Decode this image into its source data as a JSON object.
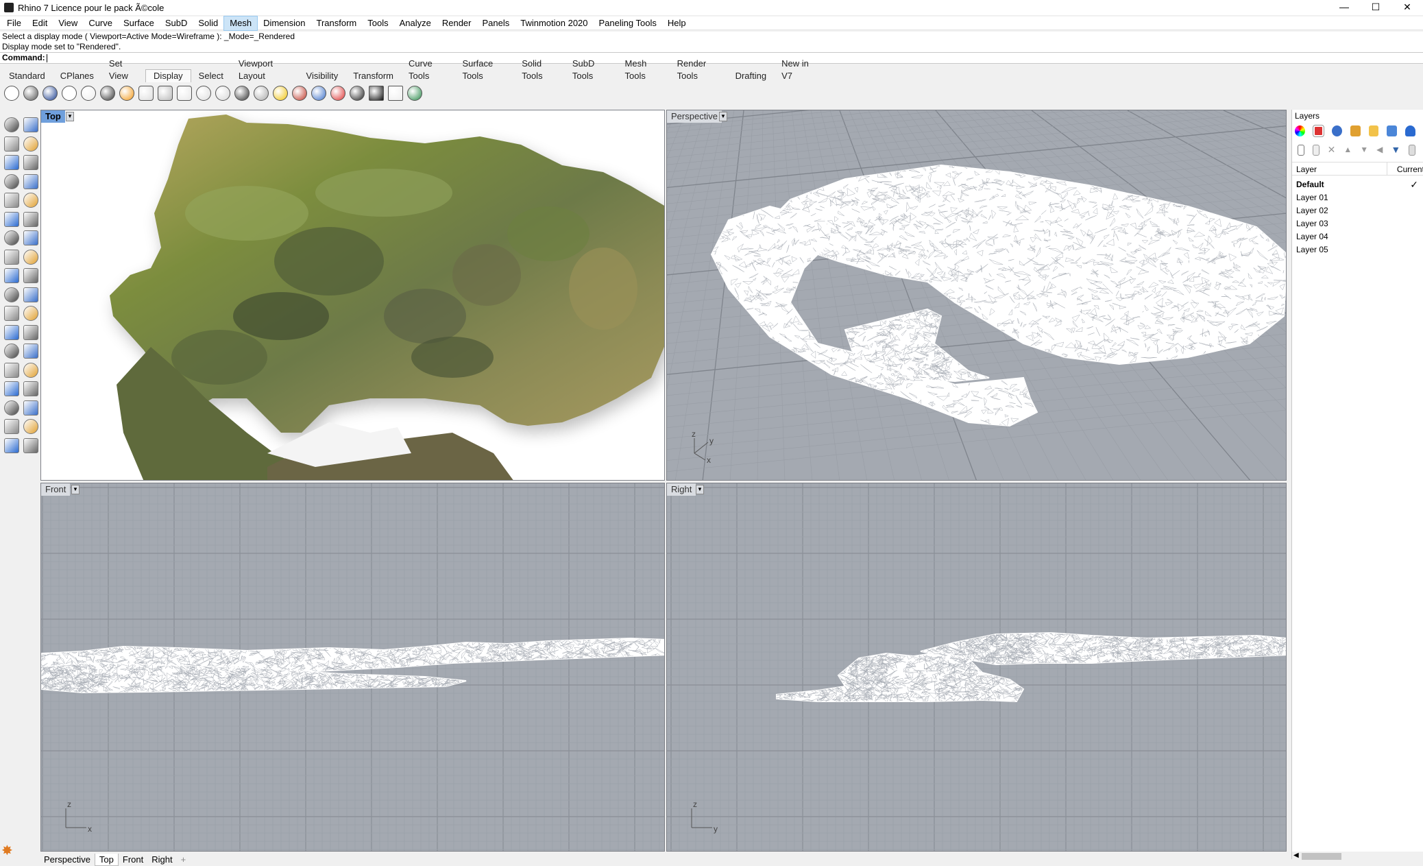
{
  "window": {
    "title": "Rhino 7 Licence pour le pack Ã©cole"
  },
  "menu": [
    "File",
    "Edit",
    "View",
    "Curve",
    "Surface",
    "SubD",
    "Solid",
    "Mesh",
    "Dimension",
    "Transform",
    "Tools",
    "Analyze",
    "Render",
    "Panels",
    "Twinmotion 2020",
    "Paneling Tools",
    "Help"
  ],
  "menu_active": "Mesh",
  "command_history": [
    "Select a display mode ( Viewport=Active  Mode=Wireframe ): _Mode=_Rendered",
    "Display mode set to \"Rendered\"."
  ],
  "command_prompt": "Command:",
  "toolbar_tabs": [
    "Standard",
    "CPlanes",
    "Set View",
    "Display",
    "Select",
    "Viewport Layout",
    "Visibility",
    "Transform",
    "Curve Tools",
    "Surface Tools",
    "Solid Tools",
    "SubD Tools",
    "Mesh Tools",
    "Render Tools",
    "Drafting",
    "New in V7"
  ],
  "toolbar_tab_active": "Display",
  "viewports": {
    "top": {
      "label": "Top"
    },
    "perspective": {
      "label": "Perspective",
      "axes": [
        "z",
        "y",
        "x"
      ]
    },
    "front": {
      "label": "Front",
      "axes": [
        "z",
        "x"
      ]
    },
    "right": {
      "label": "Right",
      "axes": [
        "z",
        "y"
      ]
    }
  },
  "layers_panel": {
    "title": "Layers",
    "col_layer": "Layer",
    "col_current": "Current",
    "rows": [
      {
        "name": "Default",
        "current": true
      },
      {
        "name": "Layer 01",
        "current": false
      },
      {
        "name": "Layer 02",
        "current": false
      },
      {
        "name": "Layer 03",
        "current": false
      },
      {
        "name": "Layer 04",
        "current": false
      },
      {
        "name": "Layer 05",
        "current": false
      }
    ]
  },
  "bottom_tabs": [
    "Perspective",
    "Top",
    "Front",
    "Right"
  ],
  "bottom_tab_active": "Top",
  "bottom_add_symbol": "+",
  "colors": {
    "viewport_bg": "#a4a9b1",
    "active_label": "#6f9fdc",
    "grid_minor": "#9ba0a8",
    "grid_major": "#8a8f97"
  }
}
